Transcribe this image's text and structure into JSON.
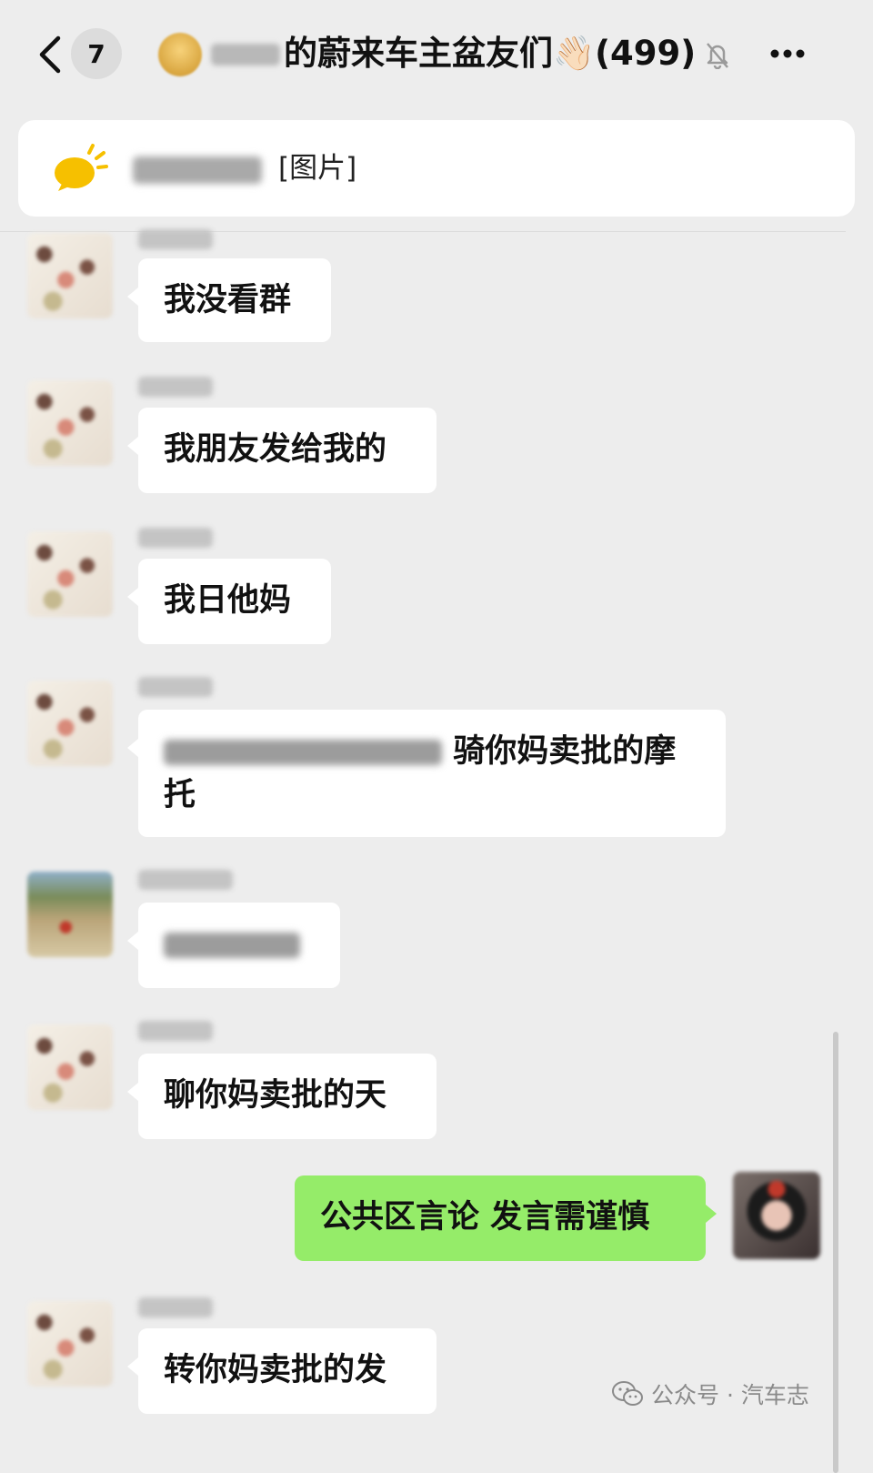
{
  "header": {
    "unread_count": "7",
    "group_title": "的蔚来车主盆友们👋🏻(499)"
  },
  "pinned": {
    "text": "[图片]"
  },
  "messages": [
    {
      "from": "other",
      "text": "我没看群"
    },
    {
      "from": "other",
      "text": "我朋友发给我的"
    },
    {
      "from": "other",
      "text": "我日他妈"
    },
    {
      "from": "other",
      "text": "骑你妈卖批的摩托"
    },
    {
      "from": "other",
      "text": ""
    },
    {
      "from": "other",
      "text": "聊你妈卖批的天"
    },
    {
      "from": "me",
      "text": "公共区言论 发言需谨慎"
    },
    {
      "from": "other",
      "text": "转你妈卖批的发"
    }
  ],
  "watermark": {
    "text": "公众号 · 汽车志"
  },
  "colors": {
    "background": "#ededed",
    "my_bubble": "#95ec69",
    "other_bubble": "#ffffff"
  }
}
